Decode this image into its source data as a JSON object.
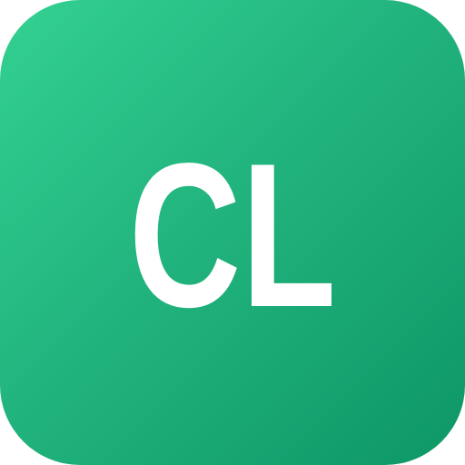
{
  "icon": {
    "monogram": "CL",
    "colors": {
      "gradient_start": "#33d191",
      "gradient_end": "#0d9766",
      "text": "#ffffff"
    }
  }
}
